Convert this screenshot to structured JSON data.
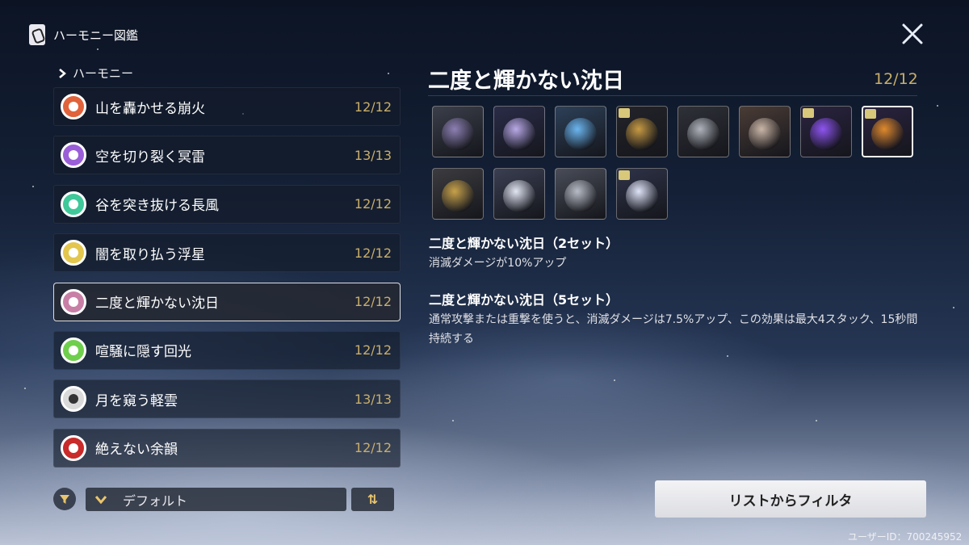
{
  "header": {
    "title": "ハーモニー図鑑"
  },
  "section_label": "ハーモニー",
  "list": [
    {
      "label": "山を轟かせる崩火",
      "count": "12/12",
      "color": "#e0633c"
    },
    {
      "label": "空を切り裂く冥雷",
      "count": "13/13",
      "color": "#9a5fd8"
    },
    {
      "label": "谷を突き抜ける長風",
      "count": "12/12",
      "color": "#3fc89a"
    },
    {
      "label": "闇を取り払う浮星",
      "count": "12/12",
      "color": "#e3c64e"
    },
    {
      "label": "二度と輝かない沈日",
      "count": "12/12",
      "color": "#c87fa6"
    },
    {
      "label": "喧騒に隠す回光",
      "count": "12/12",
      "color": "#6fcf4d"
    },
    {
      "label": "月を窺う軽雲",
      "count": "13/13",
      "color": "#dadada"
    },
    {
      "label": "絶えない余韻",
      "count": "12/12",
      "color": "#c92a2a"
    }
  ],
  "sort": {
    "label": "デフォルト",
    "order_icon": "⇅"
  },
  "detail": {
    "title": "二度と輝かない沈日",
    "count": "12/12",
    "effects": [
      {
        "title": "二度と輝かない沈日（2セット）",
        "desc": "消滅ダメージが10%アップ"
      },
      {
        "title": "二度と輝かない沈日（5セット）",
        "desc": "通常攻撃または重撃を使うと、消滅ダメージは7.5%アップ、この効果は最大4スタック、15秒間持続する"
      }
    ]
  },
  "echo_cells": [
    {
      "icon": "dark-bird-echo-icon",
      "bg": "#3b3f4a",
      "fg": "#8d7fb3",
      "badge": false
    },
    {
      "icon": "purple-orb-echo-icon",
      "bg": "#2a2c48",
      "fg": "#b9a9e6",
      "badge": false
    },
    {
      "icon": "crystal-echo-icon",
      "bg": "#2d4058",
      "fg": "#6cb6f0",
      "badge": false
    },
    {
      "icon": "shadow-beast-echo-icon",
      "bg": "#23232a",
      "fg": "#c79a44",
      "badge": true
    },
    {
      "icon": "armored-knight-echo-icon",
      "bg": "#2f3138",
      "fg": "#b0b3bc",
      "badge": false
    },
    {
      "icon": "owl-echo-icon",
      "bg": "#4a3c36",
      "fg": "#c9b6a8",
      "badge": false
    },
    {
      "icon": "void-flower-echo-icon",
      "bg": "#2a2340",
      "fg": "#8e55f0",
      "badge": true
    },
    {
      "icon": "void-flower-large-echo-icon",
      "bg": "#2a2340",
      "fg": "#e08a2d",
      "badge": true
    },
    {
      "icon": "wolf-echo-icon",
      "bg": "#3c3c40",
      "fg": "#c8a24a",
      "badge": false
    },
    {
      "icon": "white-dragon-echo-icon",
      "bg": "#3a3f52",
      "fg": "#e2e6f2",
      "badge": false
    },
    {
      "icon": "grey-spirit-echo-icon",
      "bg": "#494d58",
      "fg": "#b8bcc6",
      "badge": false
    },
    {
      "icon": "white-wings-echo-icon",
      "bg": "#2e3348",
      "fg": "#dfe4f7",
      "badge": true
    }
  ],
  "filter_list_button": "リストからフィルタ",
  "user_id": "ユーザーID：700245952"
}
